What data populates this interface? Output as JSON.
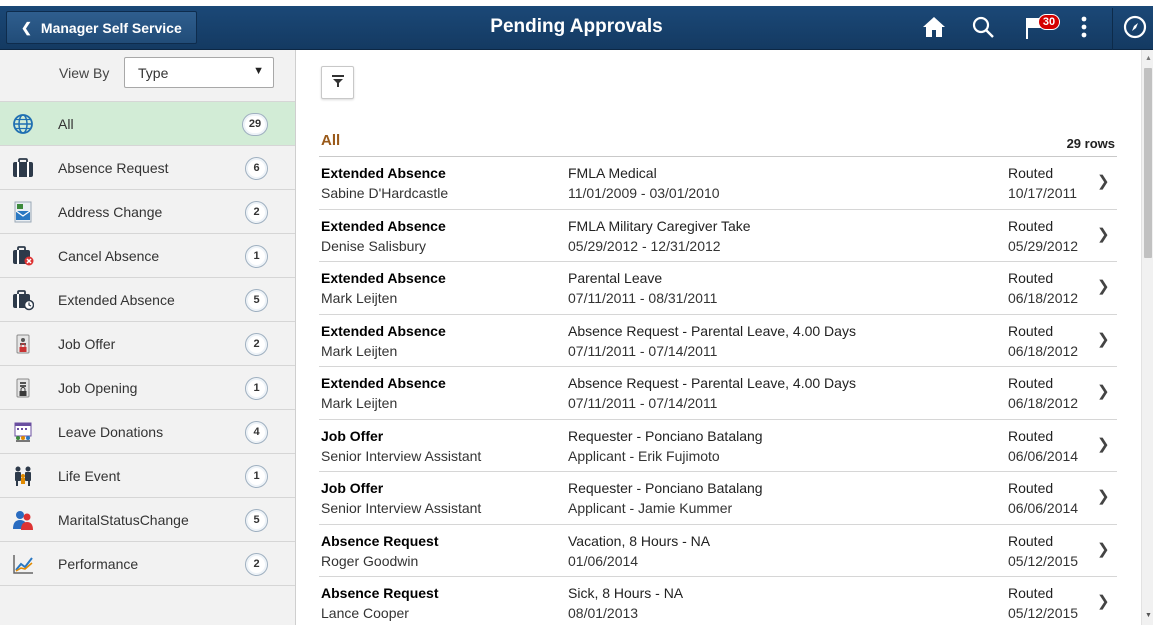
{
  "header": {
    "back_label": "Manager Self Service",
    "title": "Pending Approvals",
    "notification_count": "30",
    "icons": [
      "home-icon",
      "search-icon",
      "flag-icon",
      "kebab-menu-icon",
      "navbar-compass-icon"
    ],
    "colors": {
      "bar": "#143a62",
      "badge": "#d40000"
    }
  },
  "sidebar": {
    "view_by_label": "View By",
    "view_by_value": "Type",
    "items": [
      {
        "label": "All",
        "count": "29",
        "icon": "globe-icon",
        "active": true
      },
      {
        "label": "Absence Request",
        "count": "6",
        "icon": "briefcase-icon"
      },
      {
        "label": "Address Change",
        "count": "2",
        "icon": "envelope-icon"
      },
      {
        "label": "Cancel Absence",
        "count": "1",
        "icon": "briefcase-cancel-icon"
      },
      {
        "label": "Extended Absence",
        "count": "5",
        "icon": "briefcase-clock-icon"
      },
      {
        "label": "Job Offer",
        "count": "2",
        "icon": "badge-lock-icon"
      },
      {
        "label": "Job Opening",
        "count": "1",
        "icon": "badge-lock-icon"
      },
      {
        "label": "Leave Donations",
        "count": "4",
        "icon": "calendar-people-icon"
      },
      {
        "label": "Life Event",
        "count": "1",
        "icon": "family-icon"
      },
      {
        "label": "MaritalStatusChange",
        "count": "5",
        "icon": "couple-icon"
      },
      {
        "label": "Performance",
        "count": "2",
        "icon": "chart-line-icon"
      }
    ]
  },
  "main": {
    "section_title": "All",
    "rows_count": "29 rows",
    "rows": [
      {
        "type": "Extended Absence",
        "name": "Sabine D'Hardcastle",
        "detail": "FMLA Medical",
        "dates": "11/01/2009 - 03/01/2010",
        "status": "Routed",
        "date": "10/17/2011"
      },
      {
        "type": "Extended Absence",
        "name": "Denise Salisbury",
        "detail": "FMLA Military Caregiver Take",
        "dates": "05/29/2012 - 12/31/2012",
        "status": "Routed",
        "date": "05/29/2012"
      },
      {
        "type": "Extended Absence",
        "name": "Mark Leijten",
        "detail": "Parental Leave",
        "dates": "07/11/2011 - 08/31/2011",
        "status": "Routed",
        "date": "06/18/2012"
      },
      {
        "type": "Extended Absence",
        "name": "Mark Leijten",
        "detail": "Absence Request - Parental Leave, 4.00 Days",
        "dates": "07/11/2011 - 07/14/2011",
        "status": "Routed",
        "date": "06/18/2012"
      },
      {
        "type": "Extended Absence",
        "name": "Mark Leijten",
        "detail": "Absence Request - Parental Leave, 4.00 Days",
        "dates": "07/11/2011 - 07/14/2011",
        "status": "Routed",
        "date": "06/18/2012"
      },
      {
        "type": "Job Offer",
        "name": "Senior Interview Assistant",
        "detail": "Requester - Ponciano Batalang",
        "dates": "Applicant - Erik Fujimoto",
        "status": "Routed",
        "date": "06/06/2014"
      },
      {
        "type": "Job Offer",
        "name": "Senior Interview Assistant",
        "detail": "Requester - Ponciano Batalang",
        "dates": "Applicant - Jamie Kummer",
        "status": "Routed",
        "date": "06/06/2014"
      },
      {
        "type": "Absence Request",
        "name": "Roger Goodwin",
        "detail": "Vacation, 8 Hours - NA",
        "dates": "01/06/2014",
        "status": "Routed",
        "date": "05/12/2015"
      },
      {
        "type": "Absence Request",
        "name": "Lance Cooper",
        "detail": "Sick, 8 Hours - NA",
        "dates": "08/01/2013",
        "status": "Routed",
        "date": "05/12/2015"
      }
    ],
    "accent_color": "#9a5a1a"
  }
}
